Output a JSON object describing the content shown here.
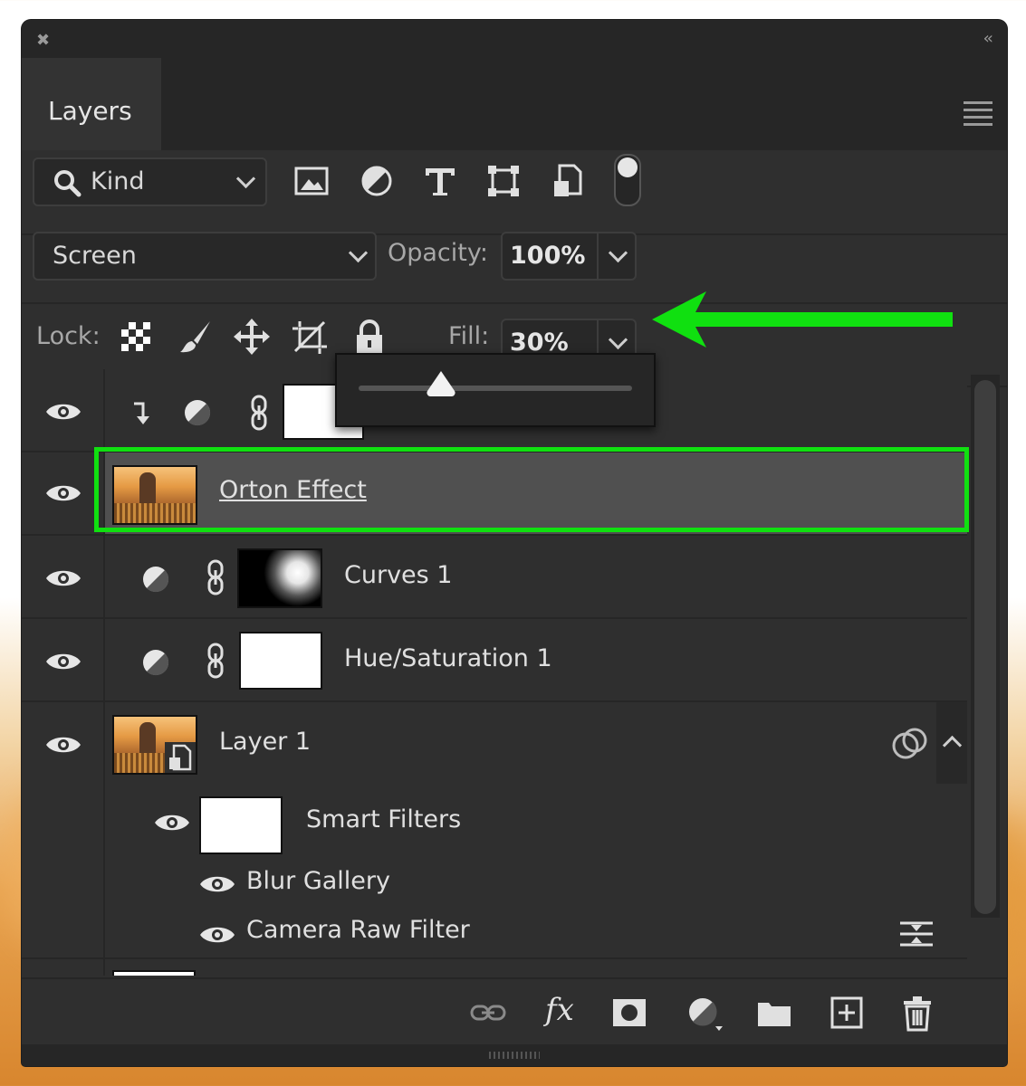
{
  "panel": {
    "tab_label": "Layers",
    "close_glyph": "✖",
    "collapse_glyph": "‹‹"
  },
  "filter": {
    "kind_label": "Kind",
    "icons": [
      "image-filter-icon",
      "adjustment-filter-icon",
      "type-filter-icon",
      "shape-filter-icon",
      "smart-object-filter-icon",
      "filter-toggle-icon"
    ]
  },
  "blend": {
    "mode": "Screen",
    "opacity_label": "Opacity:",
    "opacity_value": "100%"
  },
  "lock": {
    "label": "Lock:",
    "icons": [
      "lock-transparent-pixels-icon",
      "lock-image-pixels-icon",
      "lock-position-icon",
      "lock-artboard-icon",
      "lock-all-icon"
    ],
    "fill_label": "Fill:",
    "fill_value": "30%"
  },
  "fill_slider": {
    "value": 0.3
  },
  "layers": [
    {
      "name": "",
      "type": "adjustment-clipped",
      "visible": true
    },
    {
      "name": "Orton Effect",
      "type": "smart-object",
      "visible": true,
      "selected": true
    },
    {
      "name": "Curves 1",
      "type": "adjustment",
      "visible": true
    },
    {
      "name": "Hue/Saturation 1",
      "type": "adjustment",
      "visible": true
    },
    {
      "name": "Layer 1",
      "type": "smart-object",
      "visible": true
    },
    {
      "name": "Smart Filters",
      "type": "smart-filters",
      "visible": true
    },
    {
      "name": "Blur Gallery",
      "type": "filter",
      "visible": true
    },
    {
      "name": "Camera Raw Filter",
      "type": "filter",
      "visible": true
    }
  ],
  "bottom_toolbar": {
    "fx_label": "fx",
    "icons": [
      "link-layers-icon",
      "fx-icon",
      "add-mask-icon",
      "new-adjustment-icon",
      "new-group-icon",
      "new-layer-icon",
      "delete-layer-icon"
    ]
  },
  "colors": {
    "highlight": "#10e010",
    "panel_bg": "#2f2f2f",
    "selected_row": "#505050"
  }
}
